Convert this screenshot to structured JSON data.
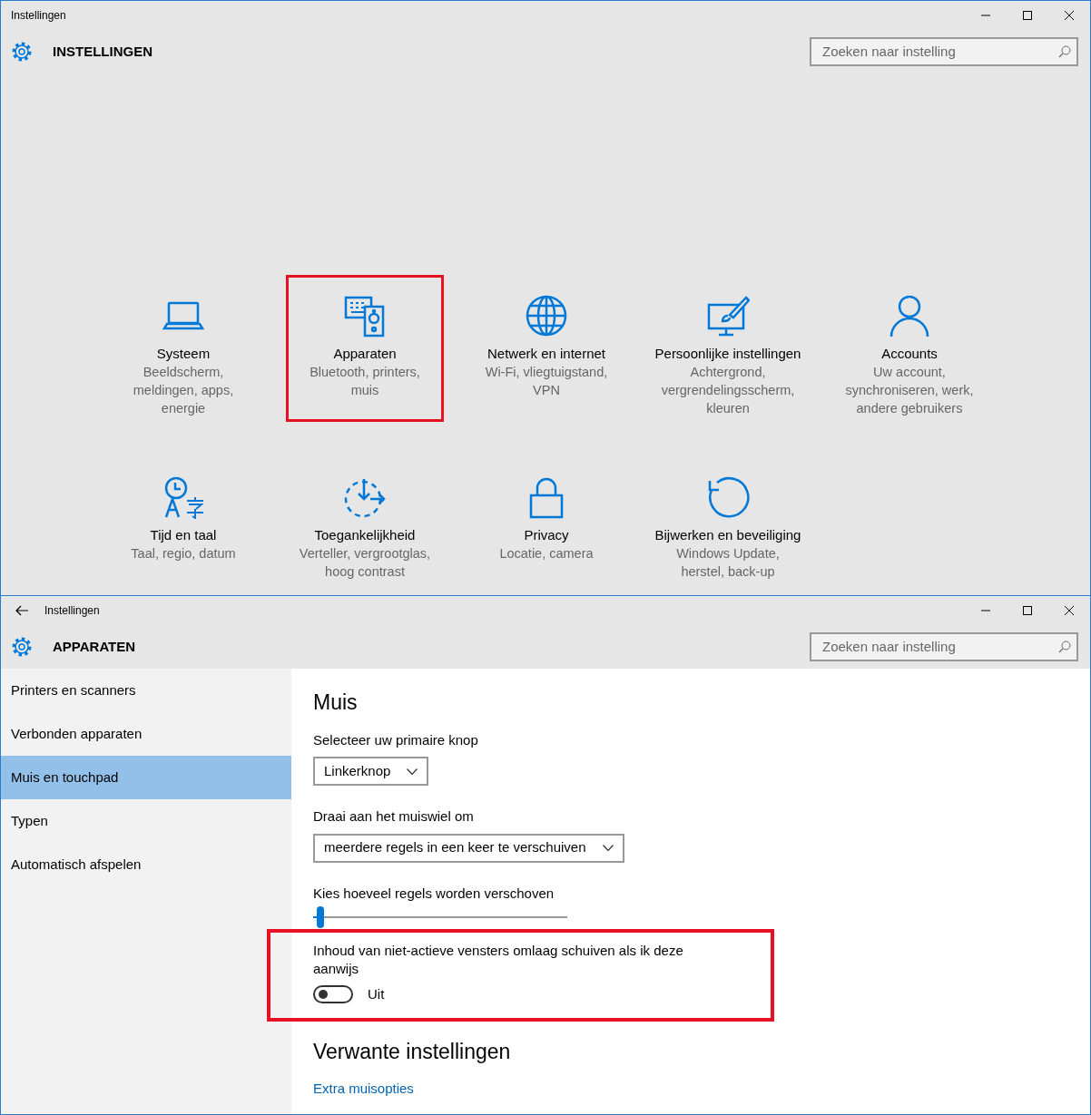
{
  "home_window": {
    "title": "Instellingen",
    "header": "INSTELLINGEN",
    "search": {
      "placeholder": "Zoeken naar instelling"
    },
    "categories": [
      {
        "kind": "laptop",
        "name": "Systeem",
        "description": "Beeldscherm, meldingen, apps, energie",
        "highlighted": false
      },
      {
        "kind": "devices",
        "name": "Apparaten",
        "description": "Bluetooth, printers, muis",
        "highlighted": true
      },
      {
        "kind": "globe",
        "name": "Netwerk en internet",
        "description": "Wi-Fi, vliegtuigstand, VPN",
        "highlighted": false
      },
      {
        "kind": "personalize",
        "name": "Persoonlijke instellingen",
        "description": "Achtergrond, vergrendelingsscherm, kleuren",
        "highlighted": false
      },
      {
        "kind": "person",
        "name": "Accounts",
        "description": "Uw account, synchroniseren, werk, andere gebruikers",
        "highlighted": false
      },
      {
        "kind": "time",
        "name": "Tijd en taal",
        "description": "Taal, regio, datum",
        "highlighted": false
      },
      {
        "kind": "access",
        "name": "Toegankelijkheid",
        "description": "Verteller, vergrootglas, hoog contrast",
        "highlighted": false
      },
      {
        "kind": "lock",
        "name": "Privacy",
        "description": "Locatie, camera",
        "highlighted": false
      },
      {
        "kind": "update",
        "name": "Bijwerken en beveiliging",
        "description": "Windows Update, herstel, back-up",
        "highlighted": false
      }
    ]
  },
  "devices_window": {
    "title": "Instellingen",
    "header": "APPARATEN",
    "search": {
      "placeholder": "Zoeken naar instelling"
    },
    "sidebar": [
      {
        "label": "Printers en scanners",
        "selected": false
      },
      {
        "label": "Verbonden apparaten",
        "selected": false
      },
      {
        "label": "Muis en touchpad",
        "selected": true
      },
      {
        "label": "Typen",
        "selected": false
      },
      {
        "label": "Automatisch afspelen",
        "selected": false
      }
    ],
    "section_title": "Muis",
    "settings": [
      {
        "kind": "dropdown",
        "label": "Selecteer uw primaire knop",
        "value": "Linkerknop"
      },
      {
        "kind": "dropdown",
        "label": "Draai aan het muiswiel om",
        "value": "meerdere regels in een keer te verschuiven"
      },
      {
        "kind": "slider",
        "label": "Kies hoeveel regels worden verschoven",
        "level": 0.03
      },
      {
        "kind": "toggle",
        "label": "Inhoud van niet-actieve vensters omlaag schuiven als ik deze aanwijs",
        "on": false,
        "state_text": "Uit",
        "highlighted": true
      }
    ],
    "related_title": "Verwante instellingen",
    "related_links": [
      "Extra muisopties"
    ]
  }
}
